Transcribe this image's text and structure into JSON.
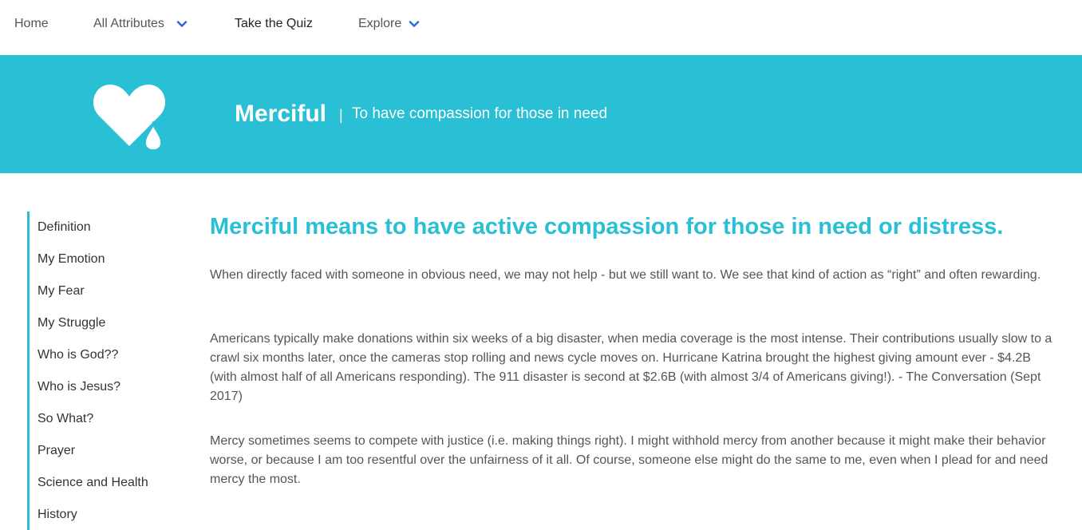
{
  "nav": {
    "items": [
      {
        "label": "Home",
        "has_dropdown": false
      },
      {
        "label": "All Attributes",
        "has_dropdown": true
      },
      {
        "label": "Take the Quiz",
        "has_dropdown": false
      },
      {
        "label": "Explore",
        "has_dropdown": true
      }
    ],
    "chevron_icon": "chevron-down-icon",
    "chevron_color": "#2a6fd6"
  },
  "banner": {
    "background": "#29bfd4",
    "icon": "heart-with-tear-icon",
    "title": "Merciful",
    "separator": "|",
    "subtitle": "To have compassion for those in need"
  },
  "sidebar": {
    "accent": "#29bfd4",
    "items": [
      {
        "label": "Definition"
      },
      {
        "label": "My Emotion"
      },
      {
        "label": "My Fear"
      },
      {
        "label": "My Struggle"
      },
      {
        "label": "Who is God??"
      },
      {
        "label": "Who is Jesus?"
      },
      {
        "label": "So What?"
      },
      {
        "label": "Prayer"
      },
      {
        "label": "Science and Health"
      },
      {
        "label": "History"
      }
    ]
  },
  "main": {
    "heading": "Merciful means to have active compassion for those in need or distress.",
    "paragraphs": [
      "When directly faced with someone in obvious need, we may not help - but we still want to. We see that kind of action as “right” and often rewarding.",
      "Americans typically make donations within six weeks of a big disaster, when media coverage is the most intense. Their contributions usually slow to a crawl six months later, once the cameras stop rolling and news cycle moves on. Hurricane Katrina brought the highest giving amount ever - $4.2B (with almost half of all Americans responding). The 911 disaster is second at $2.6B (with almost 3/4 of Americans giving!). - The Conversation (Sept 2017)",
      "Mercy sometimes seems to compete with justice (i.e. making things right). I might withhold mercy from another because it might make their behavior worse, or because I am too resentful over the unfairness of it all. Of course, someone else might do the same to me, even when I plead for and need mercy the most."
    ]
  }
}
